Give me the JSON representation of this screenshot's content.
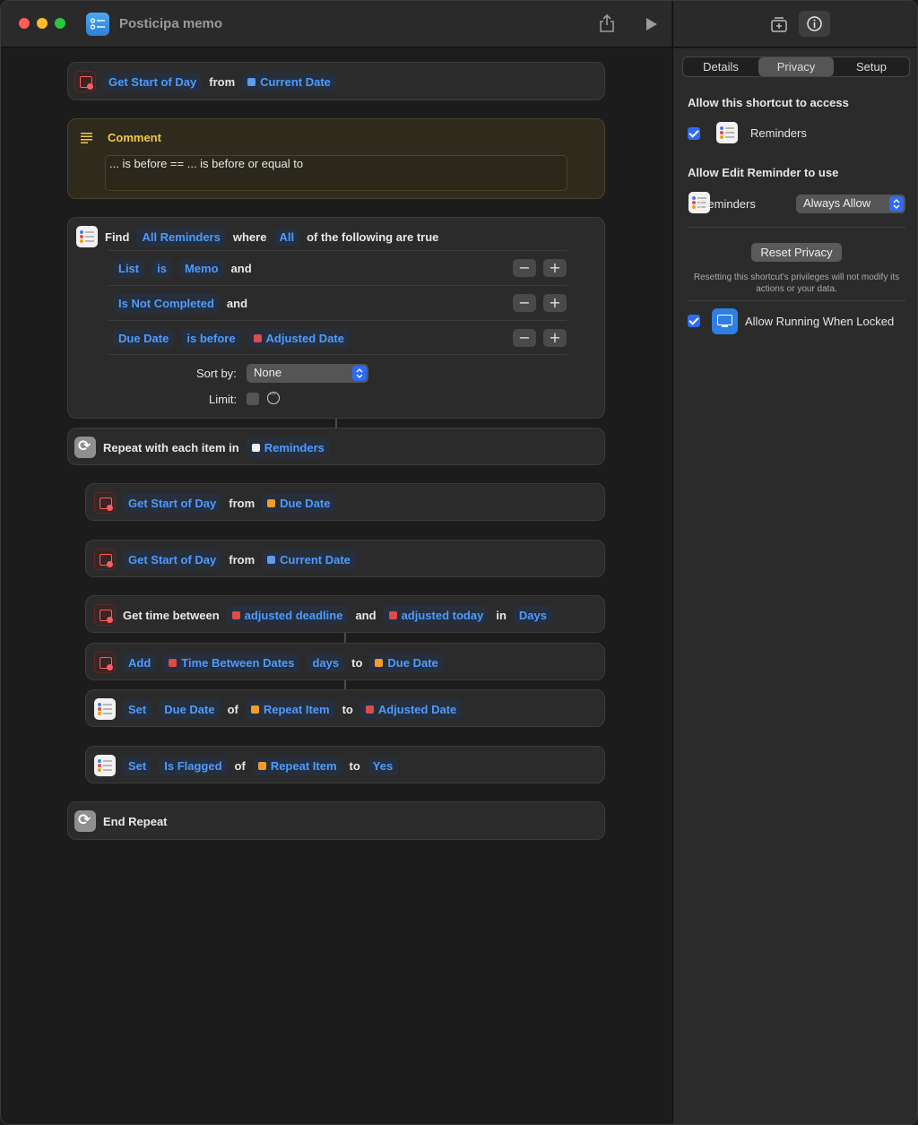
{
  "window": {
    "title": "Posticipa memo"
  },
  "panel": {
    "tabs": [
      "Details",
      "Privacy",
      "Setup"
    ],
    "active_tab": "Privacy",
    "access_heading": "Allow this shortcut to access",
    "access_app": "Reminders",
    "edit_heading": "Allow Edit Reminder to use",
    "edit_app": "Reminders",
    "edit_permission": "Always Allow",
    "reset_button": "Reset Privacy",
    "reset_note": "Resetting this shortcut's privileges will not modify its actions or your data.",
    "locked_label": "Allow Running When Locked"
  },
  "actions": {
    "a1": {
      "verb": "Get Start of Day",
      "from": "from",
      "source": "Current Date"
    },
    "comment": {
      "title": "Comment",
      "text": "... is before == ... is before or equal to"
    },
    "find": {
      "find": "Find",
      "what": "All Reminders",
      "where": "where",
      "quant": "All",
      "rest": "of the following are true",
      "conditions": [
        {
          "field": "List",
          "op": "is",
          "value": "Memo",
          "conj": "and"
        },
        {
          "field": "Is Not Completed",
          "conj": "and"
        },
        {
          "field": "Due Date",
          "op": "is before",
          "value": "Adjusted Date"
        }
      ],
      "sort_label": "Sort by:",
      "sort_value": "None",
      "limit_label": "Limit:"
    },
    "repeat": {
      "label": "Repeat with each item in",
      "source": "Reminders"
    },
    "a2": {
      "verb": "Get Start of Day",
      "from": "from",
      "source": "Due Date"
    },
    "a3": {
      "verb": "Get Start of Day",
      "from": "from",
      "source": "Current Date"
    },
    "a4": {
      "label": "Get time between",
      "v1": "adjusted deadline",
      "and": "and",
      "v2": "adjusted today",
      "in": "in",
      "unit": "Days"
    },
    "a5": {
      "verb": "Add",
      "v1": "Time Between Dates",
      "unit": "days",
      "to": "to",
      "target": "Due Date"
    },
    "a6": {
      "verb": "Set",
      "field": "Due Date",
      "of": "of",
      "item": "Repeat Item",
      "to": "to",
      "value": "Adjusted Date"
    },
    "a7": {
      "verb": "Set",
      "field": "Is Flagged",
      "of": "of",
      "item": "Repeat Item",
      "to": "to",
      "value": "Yes"
    },
    "end": {
      "label": "End Repeat"
    }
  }
}
